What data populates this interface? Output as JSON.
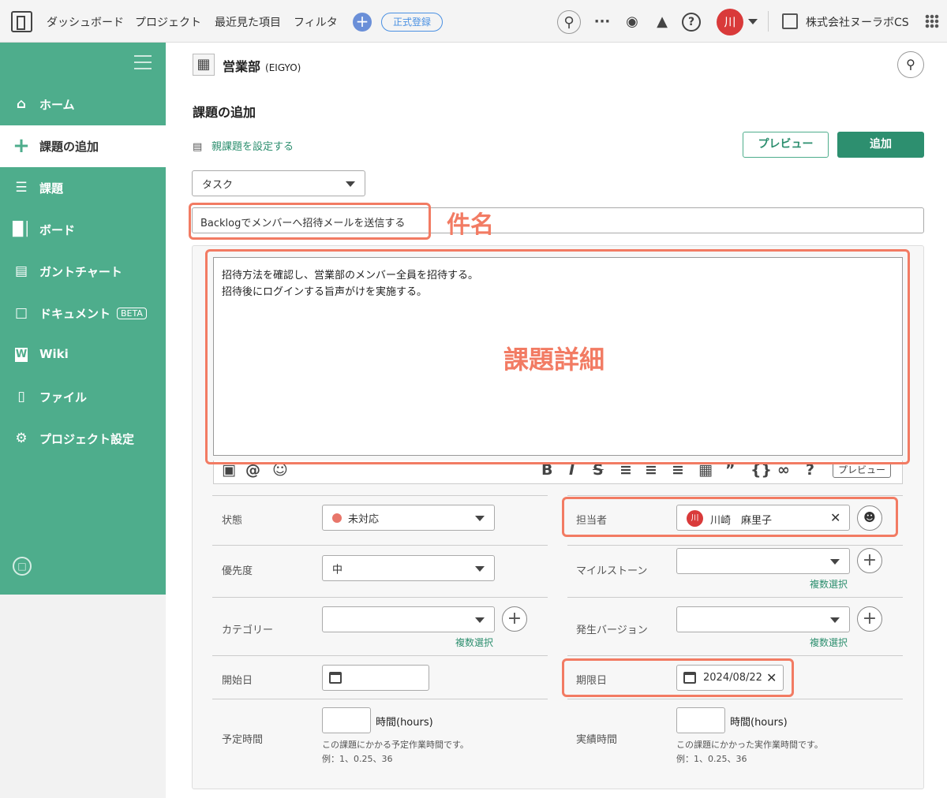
{
  "topbar": {
    "nav": [
      "ダッシュボード",
      "プロジェクト",
      "最近見た項目",
      "フィルタ"
    ],
    "register_label": "正式登録",
    "user_initial": "川",
    "org_name": "株式会社ヌーラボCS"
  },
  "sidebar": {
    "items": [
      {
        "label": "ホーム",
        "icon": "home-icon"
      },
      {
        "label": "課題の追加",
        "icon": "plus-icon"
      },
      {
        "label": "課題",
        "icon": "list-icon"
      },
      {
        "label": "ボード",
        "icon": "board-icon"
      },
      {
        "label": "ガントチャート",
        "icon": "gantt-icon"
      },
      {
        "label": "ドキュメント",
        "icon": "document-icon",
        "badge": "BETA"
      },
      {
        "label": "Wiki",
        "icon": "wiki-icon"
      },
      {
        "label": "ファイル",
        "icon": "file-icon"
      },
      {
        "label": "プロジェクト設定",
        "icon": "gear-icon"
      }
    ]
  },
  "project": {
    "name": "営業部",
    "key": "(EIGYO)"
  },
  "page": {
    "title": "課題の追加",
    "parent_link": "親課題を設定する",
    "preview_button": "プレビュー",
    "add_button": "追加"
  },
  "form": {
    "issue_type": "タスク",
    "subject": "Backlogでメンバーへ招待メールを送信する",
    "description_lines": [
      "招待方法を確認し、営業部のメンバー全員を招待する。",
      "招待後にログインする旨声がけを実施する。"
    ],
    "editor_preview": "プレビュー",
    "status_label": "状態",
    "status_value": "未対応",
    "priority_label": "優先度",
    "priority_value": "中",
    "category_label": "カテゴリー",
    "start_label": "開始日",
    "estimate_label": "予定時間",
    "assignee_label": "担当者",
    "assignee_value": "川崎　麻里子",
    "assignee_initial": "川",
    "milestone_label": "マイルストーン",
    "version_label": "発生バージョン",
    "due_label": "期限日",
    "due_value": "2024/08/22",
    "actual_label": "実績時間",
    "multi_select": "複数選択",
    "hours_unit": "時間(hours)",
    "estimate_hint": "この課題にかかる予定作業時間です。",
    "actual_hint": "この課題にかかった実作業時間です。",
    "example": "例：1、0.25、36"
  },
  "annotations": {
    "subject": "件名",
    "description": "課題詳細"
  },
  "colors": {
    "sidebar": "#4ead8c",
    "accent": "#2d8f6f",
    "annotation": "#f27b63"
  }
}
